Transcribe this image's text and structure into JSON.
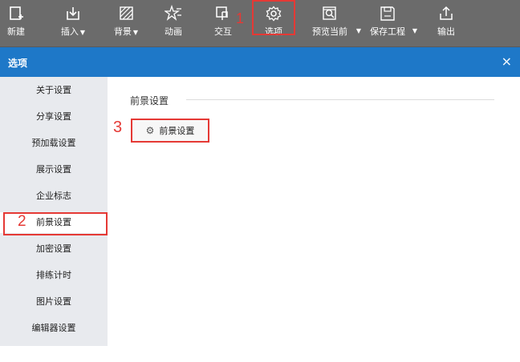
{
  "toolbar": {
    "new": "新建",
    "insert": "插入",
    "background": "背景",
    "animation": "动画",
    "interaction": "交互",
    "options": "选项",
    "preview": "预览当前",
    "save": "保存工程",
    "export": "输出"
  },
  "dialog": {
    "title": "选项",
    "close": "×"
  },
  "sidebar": {
    "items": [
      "关于设置",
      "分享设置",
      "预加载设置",
      "展示设置",
      "企业标志",
      "前景设置",
      "加密设置",
      "排练计时",
      "图片设置",
      "编辑器设置"
    ],
    "selected": "前景设置"
  },
  "content": {
    "section_title": "前景设置",
    "button_label": "前景设置"
  },
  "annotations": {
    "a1": "1",
    "a2": "2",
    "a3": "3"
  },
  "colors": {
    "toolbar_bg": "#6b6b6b",
    "title_bar": "#1e78c8",
    "sidebar_bg": "#e8eaee",
    "highlight": "#e53935"
  }
}
